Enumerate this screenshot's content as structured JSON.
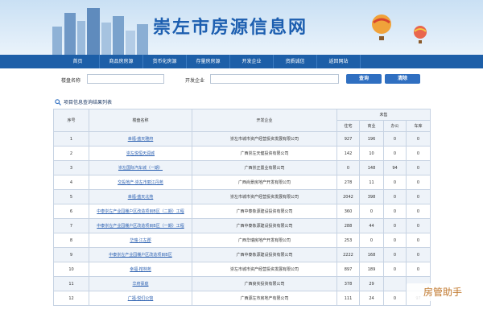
{
  "site_title": "崇左市房源信息网",
  "nav": [
    "首页",
    "商品房房源",
    "货币化房源",
    "存量房房源",
    "开发企业",
    "资质诚信",
    "返回网站"
  ],
  "search": {
    "project_label": "楼盘名称",
    "project_value": "",
    "developer_label": "开发企业",
    "developer_value": "",
    "query_button": "查询",
    "clear_button": "清除"
  },
  "section_title": "项目信息查询结果列表",
  "table": {
    "headers": {
      "no": "序号",
      "name": "楼盘名称",
      "developer": "开发企业",
      "unsold": "未售",
      "house": "住宅",
      "commercial": "商业",
      "office": "办公",
      "garage": "车库"
    },
    "rows": [
      {
        "no": "1",
        "name": "幸福·盛天雅府",
        "developer": "崇左市城市资产经营投资发展有限公司",
        "house": "927",
        "commercial": "196",
        "office": "0",
        "garage": "0"
      },
      {
        "no": "2",
        "name": "崇左悦恒天润城",
        "developer": "广西崇左天健投资有限公司",
        "house": "142",
        "commercial": "10",
        "office": "0",
        "garage": "0"
      },
      {
        "no": "3",
        "name": "崇左国际汽车城（一期）",
        "developer": "广西崇正置业有限公司",
        "house": "0",
        "commercial": "148",
        "office": "94",
        "garage": "0"
      },
      {
        "no": "4",
        "name": "交投地产·崇左市丽江丹苑",
        "developer": "广西尚景房地产开发有限公司",
        "house": "278",
        "commercial": "11",
        "office": "0",
        "garage": "0"
      },
      {
        "no": "5",
        "name": "幸福·盛天北苑",
        "developer": "崇左市城市资产经营投资发展有限公司",
        "house": "2042",
        "commercial": "398",
        "office": "0",
        "garage": "0"
      },
      {
        "no": "6",
        "name": "中泰崇左产业园棚户区改造项目B区（二期）工程",
        "developer": "广西中泰象源建设投资有限公司",
        "house": "360",
        "commercial": "0",
        "office": "0",
        "garage": "0"
      },
      {
        "no": "7",
        "name": "中泰崇左产业园棚户区改造项目B区（一期）工程",
        "developer": "广西中泰象源建设投资有限公司",
        "house": "288",
        "commercial": "44",
        "office": "0",
        "garage": "0"
      },
      {
        "no": "8",
        "name": "华瑞·江左郡",
        "developer": "广西华瑞房地产开发有限公司",
        "house": "253",
        "commercial": "0",
        "office": "0",
        "garage": "0"
      },
      {
        "no": "9",
        "name": "中泰崇左产业园棚户区改造项目B区",
        "developer": "广西中泰象源建设投资有限公司",
        "house": "2222",
        "commercial": "168",
        "office": "0",
        "garage": "0"
      },
      {
        "no": "10",
        "name": "幸福·榕林苑",
        "developer": "崇左市城市资产经营投资发展有限公司",
        "house": "897",
        "commercial": "189",
        "office": "0",
        "garage": "0"
      },
      {
        "no": "11",
        "name": "华府豪庭",
        "developer": "广西良实投资有限公司",
        "house": "378",
        "commercial": "29",
        "office": "",
        "garage": ""
      },
      {
        "no": "12",
        "name": "广福·悦们公馆",
        "developer": "广西源左市房地产有限公司",
        "house": "111",
        "commercial": "24",
        "office": "0",
        "garage": "97"
      }
    ]
  },
  "watermark": "房管助手",
  "colors": {
    "nav": "#1d5fa8",
    "title": "#1d5fa8",
    "link": "#2a5fb0",
    "row_alt": "#eef3f9"
  }
}
